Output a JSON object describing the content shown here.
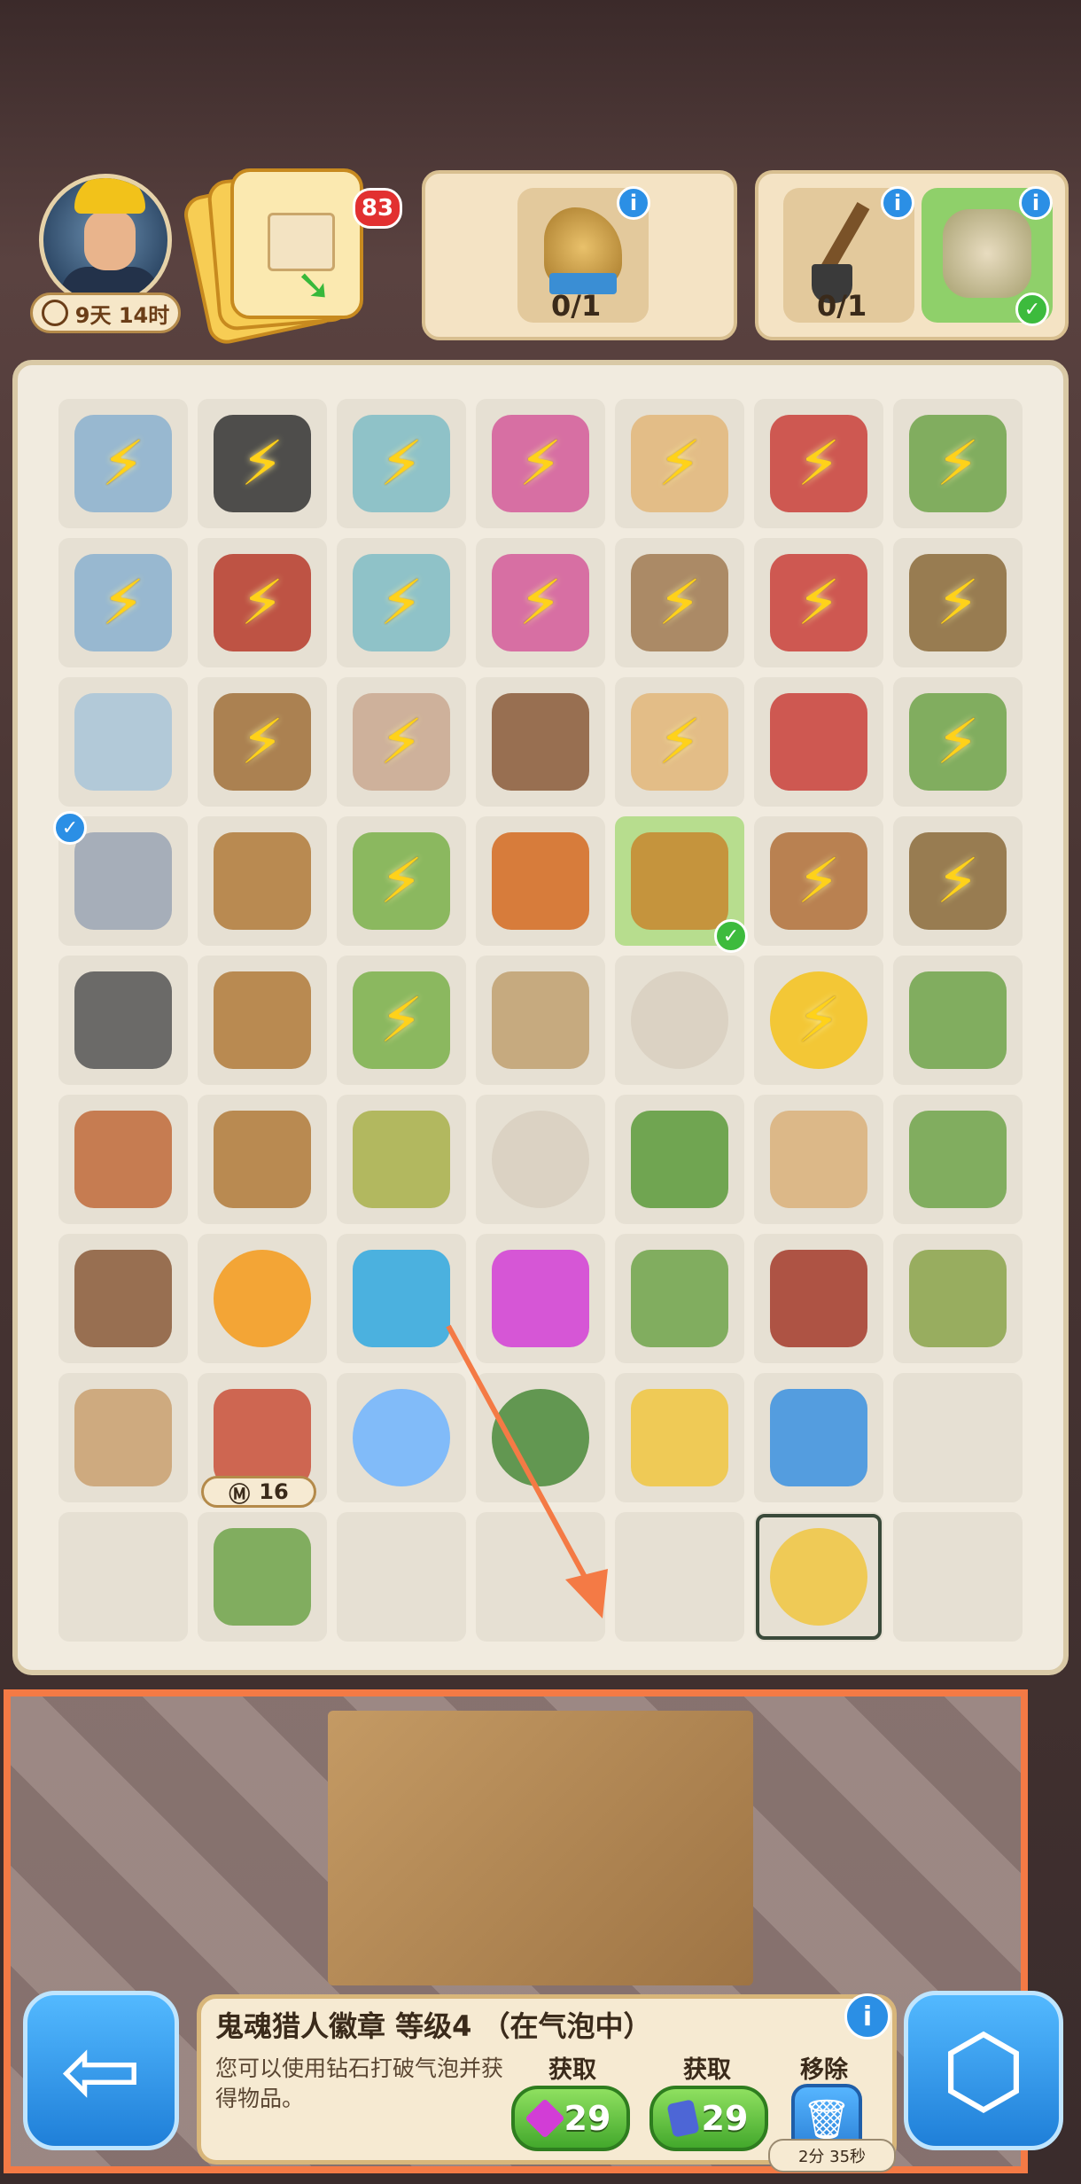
{
  "header": {
    "timer": "9天 14时",
    "inventory_count": "83"
  },
  "tasks": [
    {
      "progress": "0/1",
      "items": [
        "rabbit-statue"
      ]
    },
    {
      "progress": "0/1",
      "items": [
        "shovel",
        "gardening-gloves"
      ]
    }
  ],
  "board": {
    "building_level_badge": "16"
  },
  "selected_item": {
    "title": "鬼魂猎人徽章 等级4 （在气泡中）",
    "description": "您可以使用钻石打破气泡并获得物品。",
    "actions": [
      {
        "label": "获取",
        "value": "29",
        "currency": "gem"
      },
      {
        "label": "获取",
        "value": "29",
        "currency": "ticket"
      },
      {
        "label": "移除",
        "timer": "2分 35秒"
      }
    ]
  },
  "colors": {
    "accent_blue": "#2b8fe5",
    "accent_green": "#43a82c",
    "highlight_orange": "#f47a45"
  }
}
